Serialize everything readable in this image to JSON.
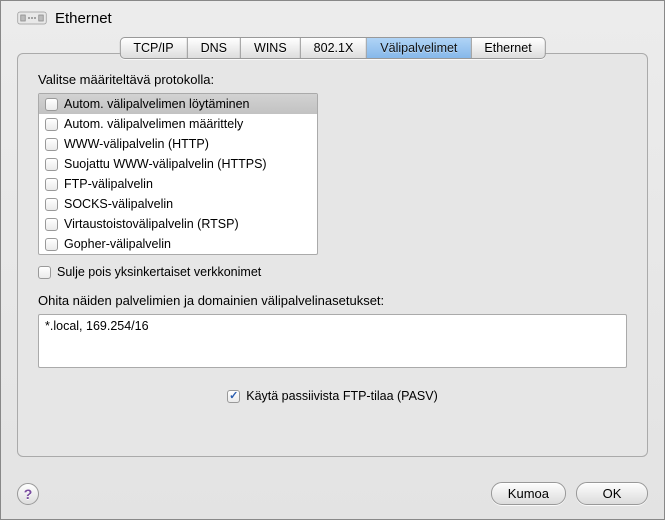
{
  "header": {
    "title": "Ethernet"
  },
  "tabs": {
    "items": [
      {
        "label": "TCP/IP"
      },
      {
        "label": "DNS"
      },
      {
        "label": "WINS"
      },
      {
        "label": "802.1X"
      },
      {
        "label": "Välipalvelimet"
      },
      {
        "label": "Ethernet"
      }
    ],
    "active_index": 4
  },
  "main": {
    "prompt": "Valitse määriteltävä protokolla:",
    "protocols": [
      {
        "label": "Autom. välipalvelimen löytäminen",
        "checked": false,
        "selected": true
      },
      {
        "label": "Autom. välipalvelimen määrittely",
        "checked": false,
        "selected": false
      },
      {
        "label": "WWW-välipalvelin (HTTP)",
        "checked": false,
        "selected": false
      },
      {
        "label": "Suojattu WWW-välipalvelin (HTTPS)",
        "checked": false,
        "selected": false
      },
      {
        "label": "FTP-välipalvelin",
        "checked": false,
        "selected": false
      },
      {
        "label": "SOCKS-välipalvelin",
        "checked": false,
        "selected": false
      },
      {
        "label": "Virtaustoistovälipalvelin (RTSP)",
        "checked": false,
        "selected": false
      },
      {
        "label": "Gopher-välipalvelin",
        "checked": false,
        "selected": false
      }
    ],
    "exclude_simple": {
      "label": "Sulje pois yksinkertaiset verkkonimet",
      "checked": false
    },
    "bypass_label": "Ohita näiden palvelimien ja domainien välipalvelinasetukset:",
    "bypass_value": "*.local, 169.254/16",
    "pasv": {
      "label": "Käytä passiivista FTP-tilaa (PASV)",
      "checked": true
    }
  },
  "footer": {
    "help": "?",
    "cancel": "Kumoa",
    "ok": "OK"
  }
}
